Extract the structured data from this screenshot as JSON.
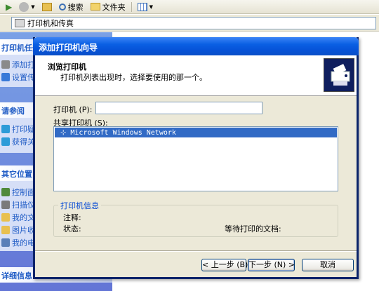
{
  "toolbar": {
    "search_label": "搜索",
    "folders_label": "文件夹"
  },
  "address": {
    "path": "打印机和传真"
  },
  "sidebar": {
    "sections": [
      {
        "title": "打印机任务",
        "items": [
          "添加打印机",
          "设置传真"
        ]
      },
      {
        "title": "请参阅",
        "items": [
          "打印疑难解答",
          "获得关于打印的帮助"
        ]
      },
      {
        "title": "其它位置",
        "items": [
          "控制面板",
          "扫描仪和照相机",
          "我的文档",
          "图片收藏",
          "我的电脑"
        ]
      },
      {
        "title": "详细信息",
        "items": []
      }
    ]
  },
  "dialog": {
    "title": "添加打印机向导",
    "header_title": "浏览打印机",
    "header_subtitle": "打印机列表出现时，选择要使用的那一个。",
    "printer_label": "打印机 (P):",
    "printer_value": "",
    "shared_label": "共享打印机 (S):",
    "shared_items": [
      "Microsoft Windows Network"
    ],
    "info_legend": "打印机信息",
    "comment_label": "注释:",
    "status_label": "状态:",
    "waiting_label": "等待打印的文档:",
    "buttons": {
      "back": "< 上一步 (B)",
      "next": "下一步 (N) >",
      "cancel": "取消"
    }
  },
  "colors": {
    "titlebar": "#0a5fe3",
    "dialog_bg": "#ece9d8",
    "selection": "#316ac5",
    "sidebar_link": "#215dc6"
  }
}
